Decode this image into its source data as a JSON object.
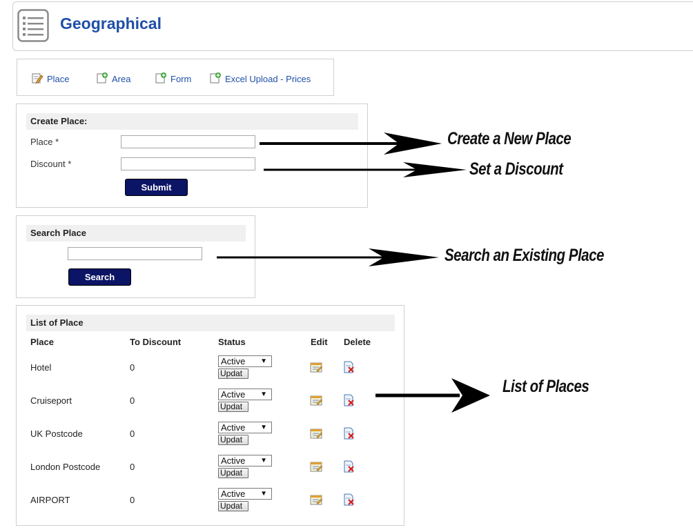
{
  "header": {
    "title": "Geographical",
    "icon": "list-icon"
  },
  "nav": {
    "items": [
      {
        "label": "Place",
        "icon": "edit-document-icon"
      },
      {
        "label": "Area",
        "icon": "add-document-icon"
      },
      {
        "label": "Form",
        "icon": "add-document-icon"
      },
      {
        "label": "Excel Upload - Prices",
        "icon": "add-document-icon"
      }
    ]
  },
  "create": {
    "heading": "Create Place:",
    "place_label": "Place *",
    "place_value": "",
    "discount_label": "Discount *",
    "discount_value": "",
    "submit_label": "Submit"
  },
  "search": {
    "heading": "Search Place",
    "query": "",
    "button_label": "Search"
  },
  "list": {
    "heading": "List of Place",
    "columns": [
      "Place",
      "To Discount",
      "Status",
      "Edit",
      "Delete"
    ],
    "rows": [
      {
        "place": "Hotel",
        "discount": "0",
        "status": "Active",
        "update": "Updat"
      },
      {
        "place": "Cruiseport",
        "discount": "0",
        "status": "Active",
        "update": "Updat"
      },
      {
        "place": "UK Postcode",
        "discount": "0",
        "status": "Active",
        "update": "Updat"
      },
      {
        "place": "London Postcode",
        "discount": "0",
        "status": "Active",
        "update": "Updat"
      },
      {
        "place": "AIRPORT",
        "discount": "0",
        "status": "Active",
        "update": "Updat"
      }
    ]
  },
  "annotations": {
    "create": "Create a New Place",
    "discount": "Set a Discount",
    "search": "Search an Existing Place",
    "list": "List of Places"
  },
  "colors": {
    "title_blue": "#1f4fa8",
    "button_navy": "#0c1466",
    "panel_head_bg": "#f0f0f0"
  }
}
